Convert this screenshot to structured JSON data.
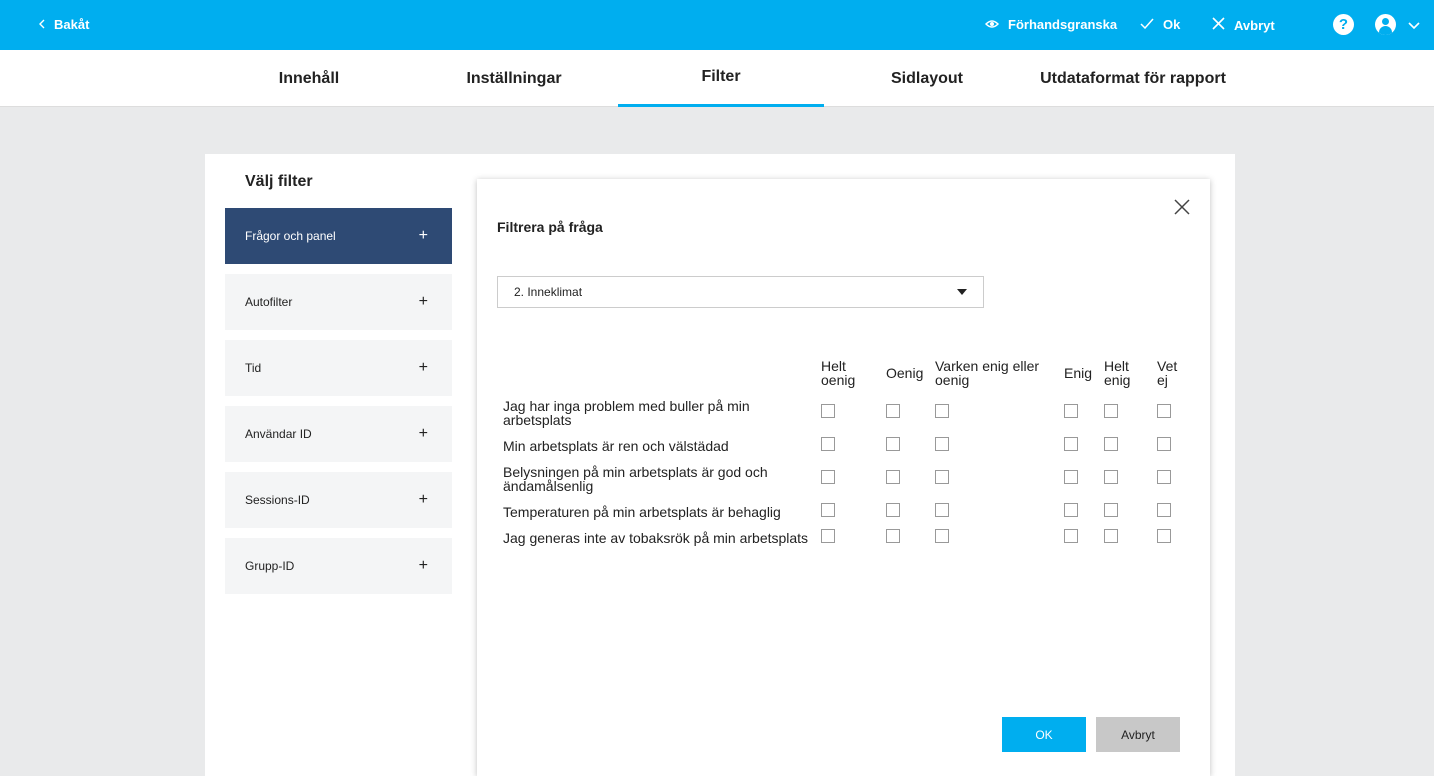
{
  "topbar": {
    "back_label": "Bakåt",
    "preview_label": "Förhandsgranska",
    "ok_label": "Ok",
    "cancel_label": "Avbryt",
    "help_symbol": "?",
    "accent_color": "#00aeef"
  },
  "tabs": [
    {
      "label": "Innehåll",
      "active": false
    },
    {
      "label": "Inställningar",
      "active": false
    },
    {
      "label": "Filter",
      "active": true
    },
    {
      "label": "Sidlayout",
      "active": false
    },
    {
      "label": "Utdataformat för rapport",
      "active": false
    }
  ],
  "sidebar": {
    "title": "Välj filter",
    "items": [
      {
        "label": "Frågor och panel",
        "active": true
      },
      {
        "label": "Autofilter",
        "active": false
      },
      {
        "label": "Tid",
        "active": false
      },
      {
        "label": "Användar ID",
        "active": false
      },
      {
        "label": "Sessions-ID",
        "active": false
      },
      {
        "label": "Grupp-ID",
        "active": false
      }
    ],
    "plus_symbol": "+",
    "active_color": "#2e4a74"
  },
  "dialog": {
    "title": "Filtrera på fråga",
    "select_value": "2. Inneklimat",
    "columns": [
      "Helt oenig",
      "Oenig",
      "Varken enig eller oenig",
      "Enig",
      "Helt enig",
      "Vet ej"
    ],
    "rows": [
      "Jag har inga problem med buller på min arbetsplats",
      "Min arbetsplats är ren och välstädad",
      "Belysningen på min arbetsplats är god och ändamålsenlig",
      "Temperaturen på min arbetsplats är behaglig",
      "Jag generas inte av tobaksrök på min arbetsplats"
    ],
    "ok_button": "OK",
    "cancel_button": "Avbryt"
  }
}
